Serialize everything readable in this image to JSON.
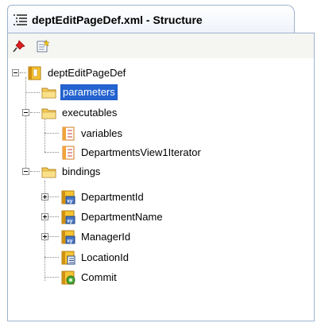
{
  "panel": {
    "title": "deptEditPageDef.xml - Structure",
    "icons": {
      "title": "structure-list-icon",
      "pin": "pushpin-icon",
      "new": "new-item-icon"
    }
  },
  "tree": {
    "root": "deptEditPageDef",
    "parameters": "parameters",
    "executables": "executables",
    "variables": "variables",
    "iterator": "DepartmentsView1Iterator",
    "bindings": "bindings",
    "departmentId": "DepartmentId",
    "departmentName": "DepartmentName",
    "managerId": "ManagerId",
    "locationId": "LocationId",
    "commit": "Commit"
  },
  "colors": {
    "selection": "#2463d0",
    "border": "#9db3cf",
    "folder": "#f4cb52"
  }
}
